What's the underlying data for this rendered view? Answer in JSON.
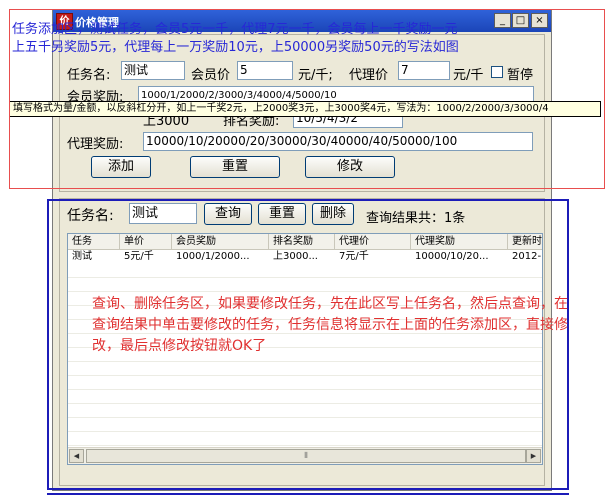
{
  "window": {
    "title": "价格管理",
    "app_icon": "app-icon",
    "buttons": {
      "minimize": "_",
      "maximize": "□",
      "close": "×"
    }
  },
  "add_section": {
    "task_name_label": "任务名:",
    "task_name_value": "测试",
    "member_price_label": "会员价",
    "member_price_value": "5",
    "per_thousand_1": "元/千;",
    "agent_price_label": "代理价",
    "agent_price_value": "7",
    "per_thousand_2": "元/千",
    "pause_label": "暂停",
    "pause_checked": false,
    "member_reward_label": "会员奖励:",
    "member_reward_value": "1000/1/2000/2/3000/3/4000/4/5000/10",
    "rank_reward_label": "排名奖励:",
    "rank_reward_value": "10/5/4/3/2",
    "top_label_partial": "上3000",
    "agent_reward_label": "代理奖励:",
    "agent_reward_value": "10000/10/20000/20/30000/30/40000/40/50000/100",
    "add_button": "添加",
    "reset_button": "重置",
    "modify_button": "修改"
  },
  "tooltip": "填写格式为量/金额，以反斜杠分开，如上一千奖2元，上2000奖3元，上3000奖4元，写法为：1000/2/2000/3/3000/4",
  "query_section": {
    "task_name_label": "任务名:",
    "task_name_value": "测试",
    "query_button": "查询",
    "reset_button": "重置",
    "delete_button": "删除",
    "result_label": "查询结果共：1条"
  },
  "table": {
    "columns": [
      "任务",
      "单价",
      "会员奖励",
      "排名奖励",
      "代理价",
      "代理奖励",
      "更新时"
    ],
    "rows": [
      [
        "测试",
        "5元/千",
        "1000/1/2000...",
        "上3000...",
        "7元/千",
        "10000/10/20...",
        "2012-"
      ]
    ],
    "scroll_grip": "⦀"
  },
  "annotations": {
    "blue_line1": "任务添加区，测试任务，会员5元一千，代理7元一千，会员每上一千奖励一元",
    "blue_line2": "上五千另奖励5元，代理每上一万奖励10元，上50000另奖励50元的写法如图",
    "red_note": "查询、删除任务区，如果要修改任务，先在此区写上任务名，然后点查询，在查询结果中单击要修改的任务，任务信息将显示在上面的任务添加区，直接修改，最后点修改按钮就OK了"
  },
  "colors": {
    "titlebar": "#1b45b8",
    "window_bg": "#ece9d8",
    "annotation_blue": "#2727d6",
    "annotation_red": "#e03030",
    "tooltip_bg": "#ffffe1"
  }
}
